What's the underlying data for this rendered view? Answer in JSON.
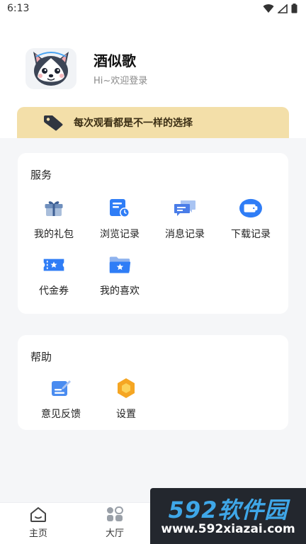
{
  "status_bar": {
    "time": "6:13"
  },
  "profile": {
    "username": "酒似歌",
    "login_hint": "Hi~欢迎登录"
  },
  "vip_banner": {
    "text": "每次观看都是不一样的选择"
  },
  "services": {
    "title": "服务",
    "items": [
      {
        "label": "我的礼包",
        "icon": "gift-icon"
      },
      {
        "label": "浏览记录",
        "icon": "history-icon"
      },
      {
        "label": "消息记录",
        "icon": "message-icon"
      },
      {
        "label": "下载记录",
        "icon": "download-icon"
      },
      {
        "label": "代金券",
        "icon": "coupon-icon"
      },
      {
        "label": "我的喜欢",
        "icon": "favorite-folder-icon"
      }
    ]
  },
  "help": {
    "title": "帮助",
    "items": [
      {
        "label": "意见反馈",
        "icon": "feedback-icon"
      },
      {
        "label": "设置",
        "icon": "settings-icon"
      }
    ]
  },
  "bottom_nav": {
    "items": [
      {
        "label": "主页",
        "icon": "home-icon"
      },
      {
        "label": "大厅",
        "icon": "hall-icon"
      }
    ]
  },
  "watermark": {
    "logo": "592软件园",
    "url": "www.592xiazai.com"
  },
  "colors": {
    "accent_blue": "#2f7df6",
    "banner_gold": "#f3dfa9",
    "settings_orange": "#f5a623"
  }
}
